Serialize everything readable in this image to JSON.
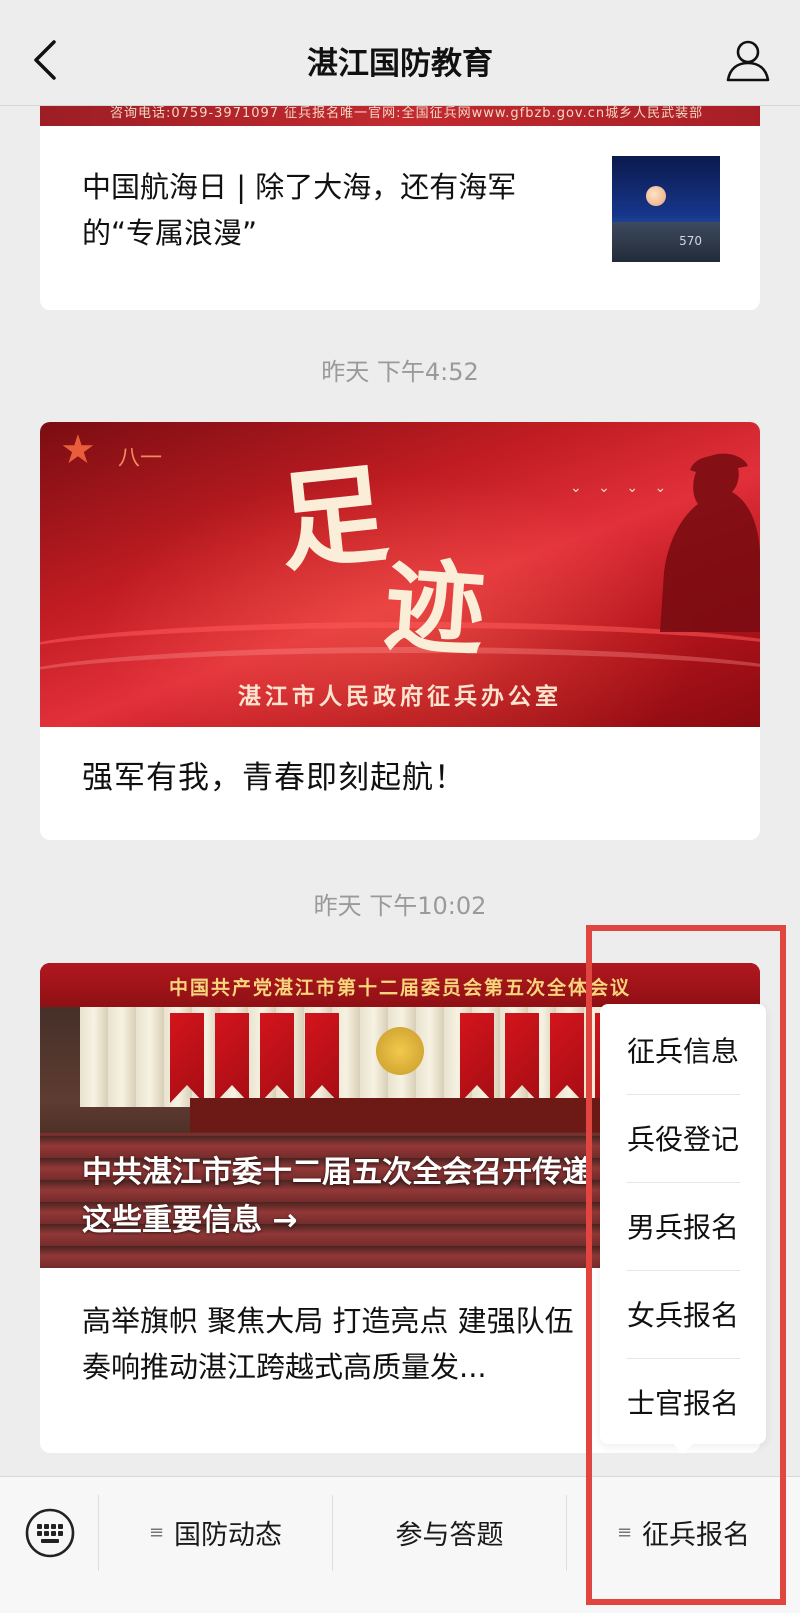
{
  "header": {
    "title": "湛江国防教育",
    "back_icon": "chevron-left-icon",
    "user_icon": "user-icon"
  },
  "feed": {
    "card1": {
      "strip_text": "咨询电话:0759-3971097  征兵报名唯一官网:全国征兵网www.gfbzb.gov.cn城乡人民武装部",
      "headline": "中国航海日 | 除了大海，还有海军的“专属浪漫”",
      "thumb_number": "570"
    },
    "time1": "昨天 下午4:52",
    "card2": {
      "calli_1": "足",
      "calli_2": "迹",
      "bayi": "八一",
      "caption": "湛江市人民政府征兵办公室",
      "headline": "强军有我，青春即刻起航！"
    },
    "time2": "昨天 下午10:02",
    "card3": {
      "stage_text": "中国共产党湛江市第十二届委员会第五次全体会议",
      "overlay_title": "中共湛江市委十二届五次全会召开传递这些重要信息 →",
      "headline": "高举旗帜 聚焦大局 打造亮点 建强队伍 奏响推动湛江跨越式高质量发..."
    }
  },
  "popup_menu": {
    "items": [
      "征兵信息",
      "兵役登记",
      "男兵报名",
      "女兵报名",
      "士官报名"
    ]
  },
  "menubar": {
    "keyboard_icon": "keyboard-icon",
    "tabs": [
      {
        "label": "国防动态",
        "has_submenu": true
      },
      {
        "label": "参与答题",
        "has_submenu": false
      },
      {
        "label": "征兵报名",
        "has_submenu": true
      }
    ],
    "submenu_glyph": "≡"
  },
  "colors": {
    "annotation": "#e1453f",
    "background": "#ededed"
  }
}
